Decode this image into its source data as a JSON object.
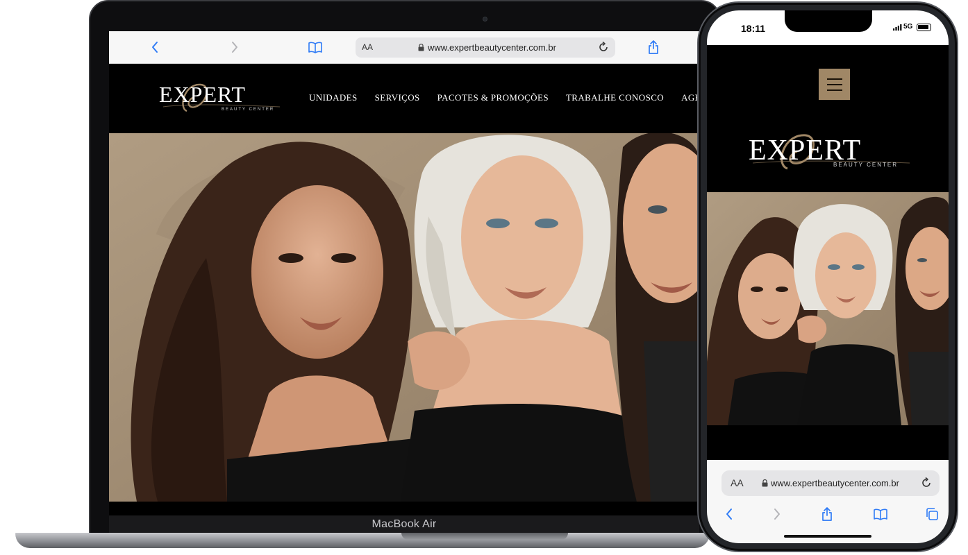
{
  "laptop": {
    "model_label": "MacBook Air",
    "browser": {
      "text_size_label": "AA",
      "url": "www.expertbeautycenter.com.br",
      "back_icon": "chevron-left-icon",
      "forward_icon": "chevron-right-icon",
      "bookmarks_icon": "book-icon",
      "share_icon": "share-icon",
      "reload_icon": "reload-icon"
    },
    "site": {
      "logo_main": "EXPERT",
      "logo_sub": "BEAUTY CENTER",
      "nav": [
        "UNIDADES",
        "SERVIÇOS",
        "PACOTES & PROMOÇÕES",
        "TRABALHE CONOSCO",
        "AGENDA"
      ]
    }
  },
  "phone": {
    "status": {
      "time": "18:11",
      "network": "5G"
    },
    "site": {
      "menu_icon": "hamburger-menu-icon",
      "logo_main": "EXPERT",
      "logo_sub": "BEAUTY CENTER"
    },
    "browser": {
      "text_size_label": "AA",
      "url": "www.expertbeautycenter.com.br",
      "back_icon": "chevron-left-icon",
      "forward_icon": "chevron-right-icon",
      "share_icon": "share-icon",
      "bookmarks_icon": "book-icon",
      "tabs_icon": "tabs-icon"
    }
  },
  "colors": {
    "accent_gold": "#a08766",
    "ios_blue": "#2f7bf6",
    "hero_bg": "#a89378"
  }
}
